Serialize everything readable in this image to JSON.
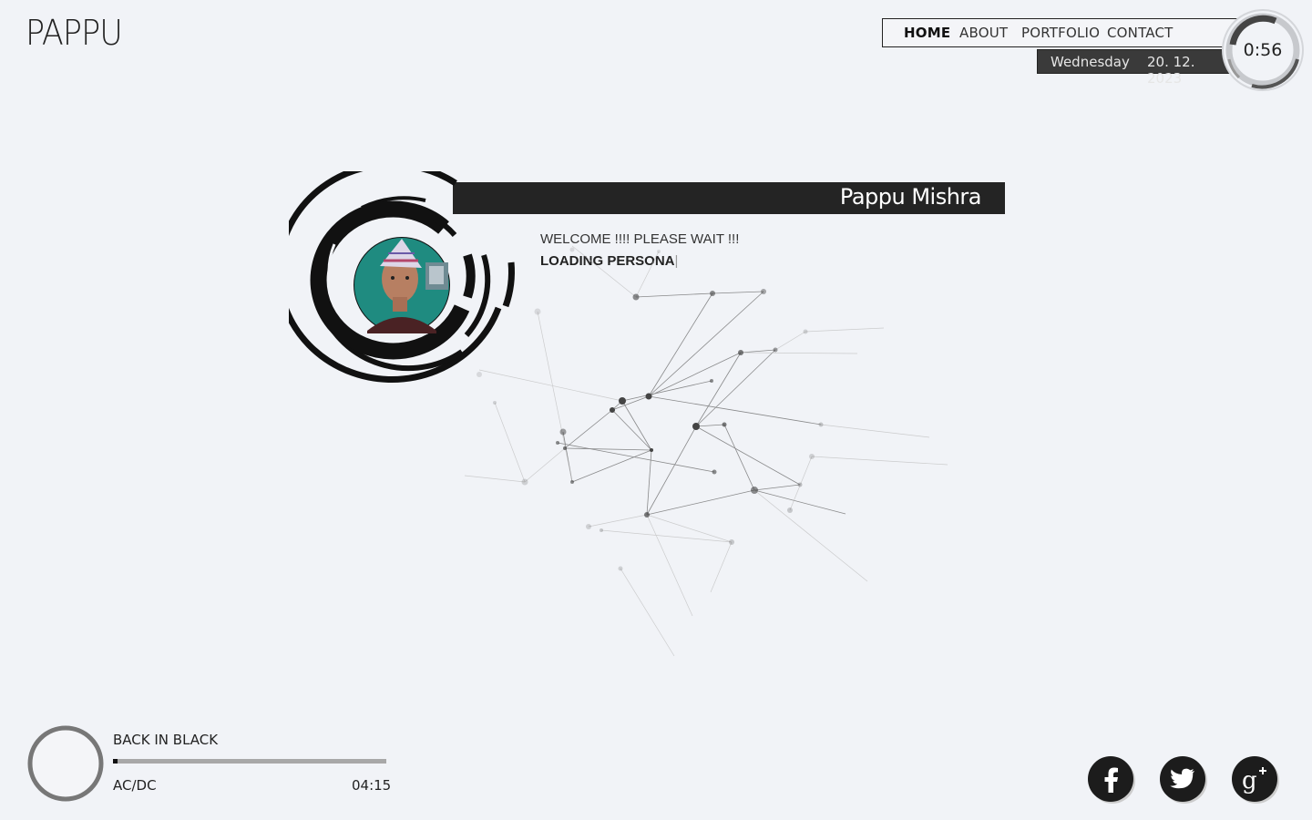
{
  "brand": {
    "logo_text": "PAPPU"
  },
  "nav": {
    "items": [
      {
        "label": "HOME",
        "active": true
      },
      {
        "label": "ABOUT",
        "active": false
      },
      {
        "label": "PORTFOLIO",
        "active": false
      },
      {
        "label": "CONTACT",
        "active": false
      }
    ]
  },
  "date": {
    "weekday": "Wednesday",
    "value": "20. 12. 2023"
  },
  "clock": {
    "time": "0:56"
  },
  "profile": {
    "name": "Pappu Mishra",
    "welcome": "WELCOME !!!! PLEASE WAIT !!!",
    "loading": "LOADING PERSONA",
    "caret": "|"
  },
  "player": {
    "title": "BACK IN BLACK",
    "artist": "AC/DC",
    "duration": "04:15",
    "progress": 0.017
  },
  "social": [
    {
      "icon": "facebook-icon"
    },
    {
      "icon": "twitter-icon"
    },
    {
      "icon": "google-plus-icon"
    }
  ],
  "colors": {
    "background": "#f1f3f7",
    "dark": "#242424",
    "accent": "#111111"
  }
}
